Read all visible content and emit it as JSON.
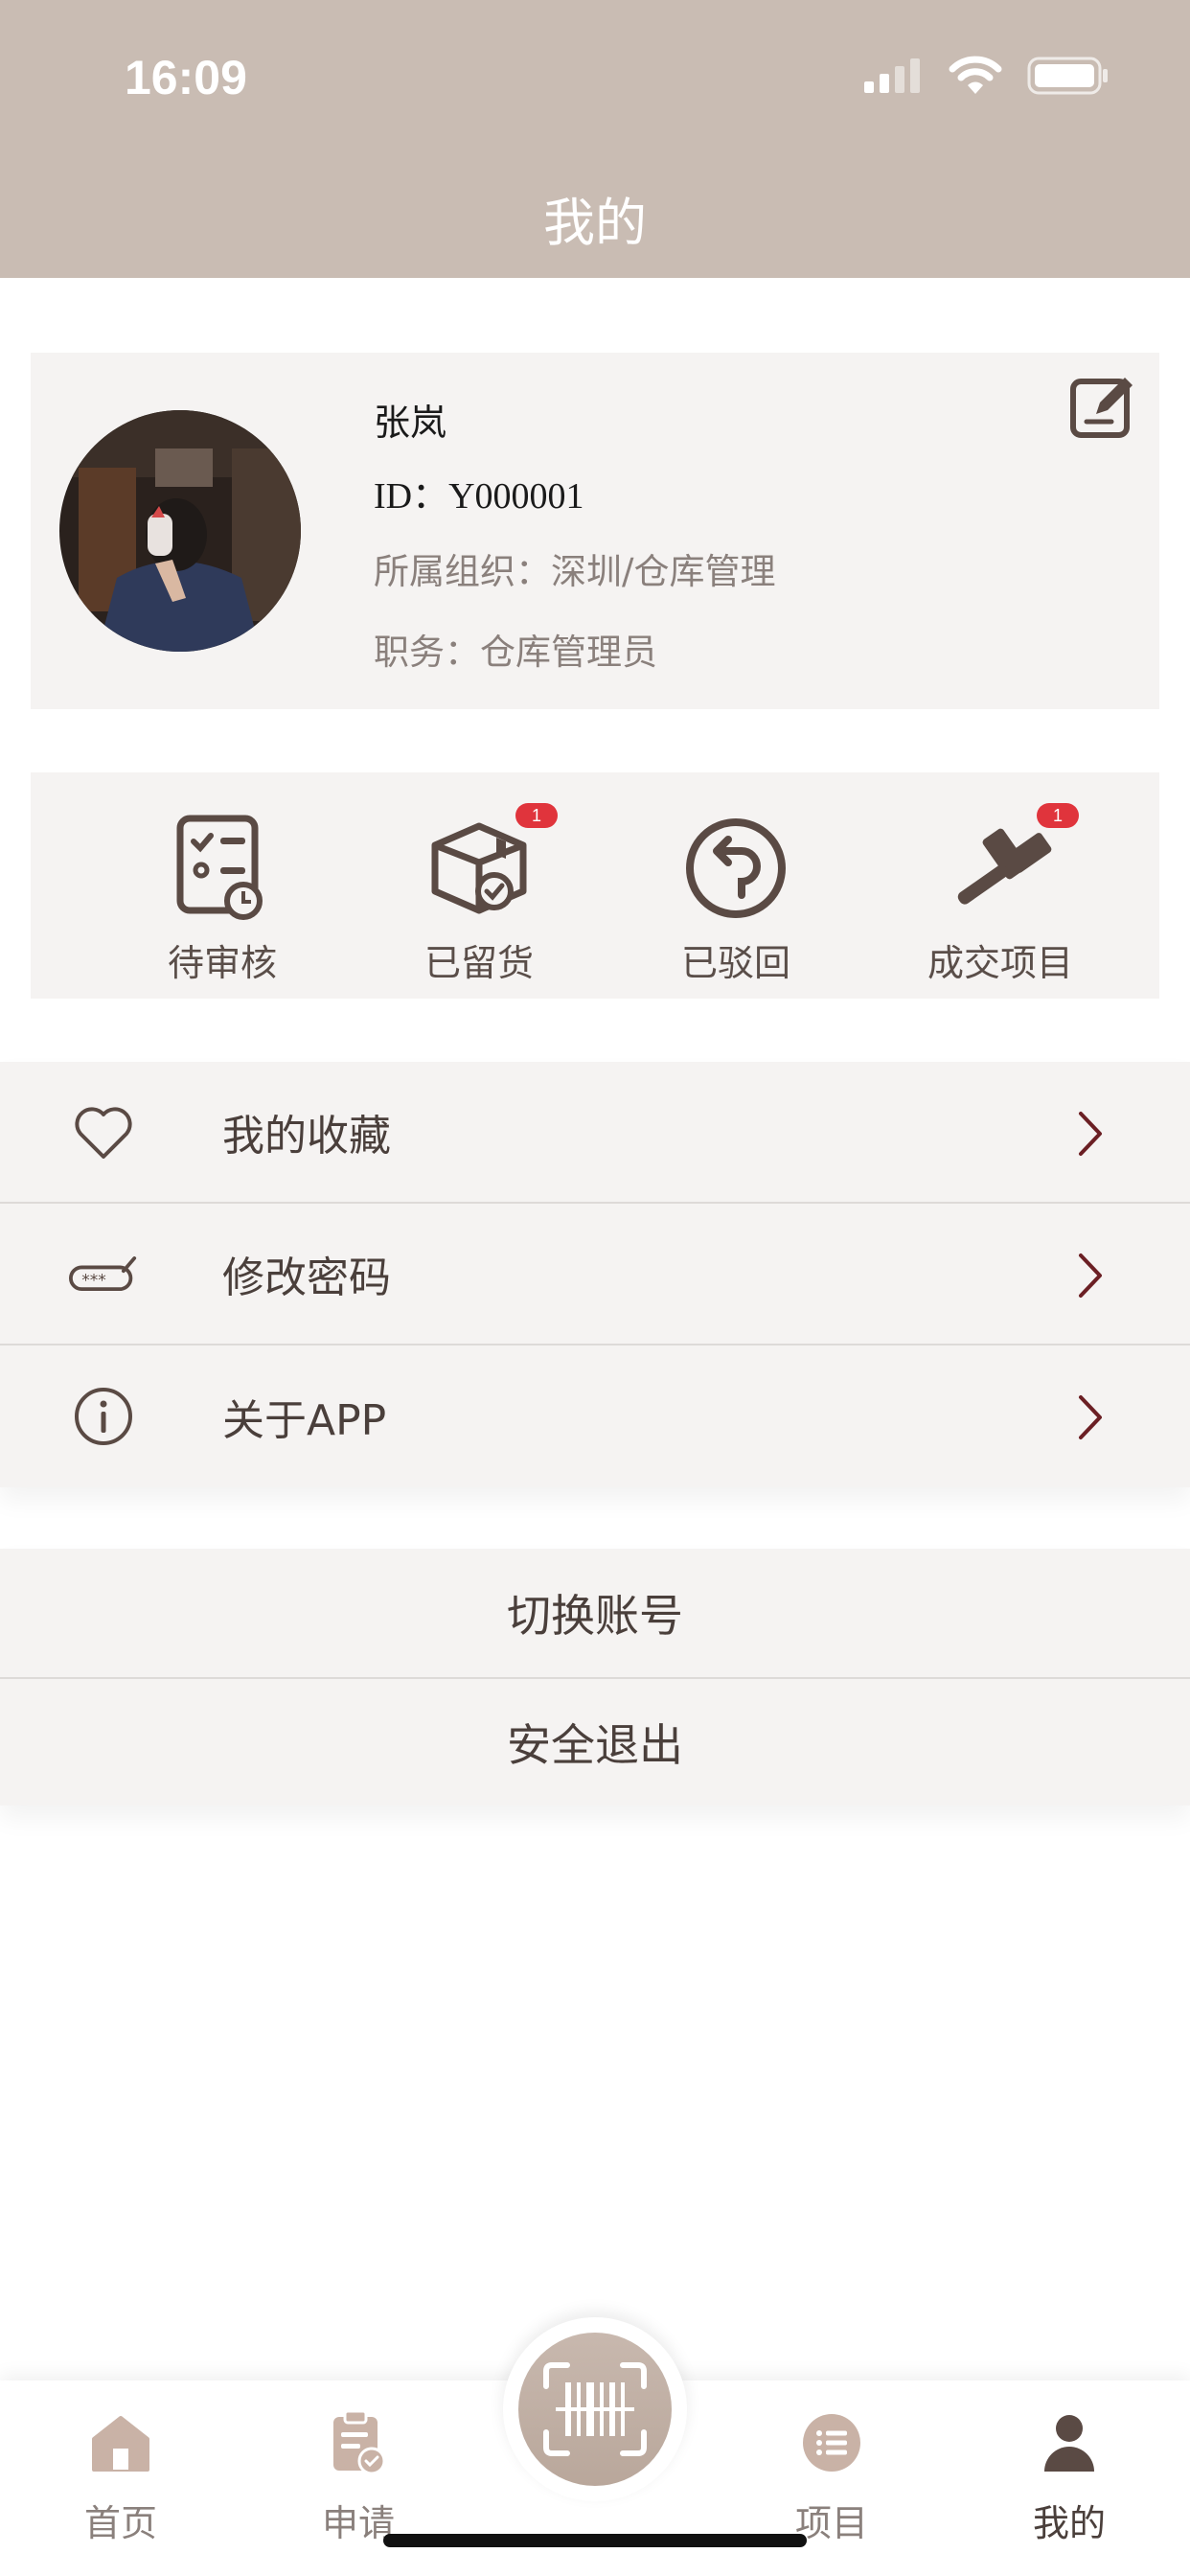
{
  "status_bar": {
    "time": "16:09",
    "icons": [
      "signal-icon",
      "wifi-icon",
      "battery-icon"
    ]
  },
  "header": {
    "title": "我的"
  },
  "profile": {
    "name": "张岚",
    "id": "ID：Y000001",
    "organization": "所属组织：深圳/仓库管理",
    "role": "职务：仓库管理员"
  },
  "actions": [
    {
      "label": "待审核",
      "icon": "pending-review-icon",
      "badge": ""
    },
    {
      "label": "已留货",
      "icon": "reserved-goods-icon",
      "badge": "1"
    },
    {
      "label": "已驳回",
      "icon": "rejected-icon",
      "badge": ""
    },
    {
      "label": "成交项目",
      "icon": "auction-gavel-icon",
      "badge": "1"
    }
  ],
  "menu": [
    {
      "label": "我的收藏",
      "icon": "heart-icon"
    },
    {
      "label": "修改密码",
      "icon": "password-icon"
    },
    {
      "label": "关于APP",
      "icon": "info-icon"
    }
  ],
  "account": {
    "switch_label": "切换账号",
    "logout_label": "安全退出"
  },
  "tabbar": [
    {
      "label": "首页",
      "icon": "home-icon"
    },
    {
      "label": "申请",
      "icon": "application-icon"
    },
    {
      "label": "项目",
      "icon": "project-list-icon"
    },
    {
      "label": "我的",
      "icon": "user-icon"
    }
  ],
  "colors": {
    "header_bg": "#c9bcb3",
    "card_bg": "#f5f3f2",
    "icon_dark": "#5a4a44",
    "chevron": "#6b1f24",
    "badge": "#e0343c"
  }
}
